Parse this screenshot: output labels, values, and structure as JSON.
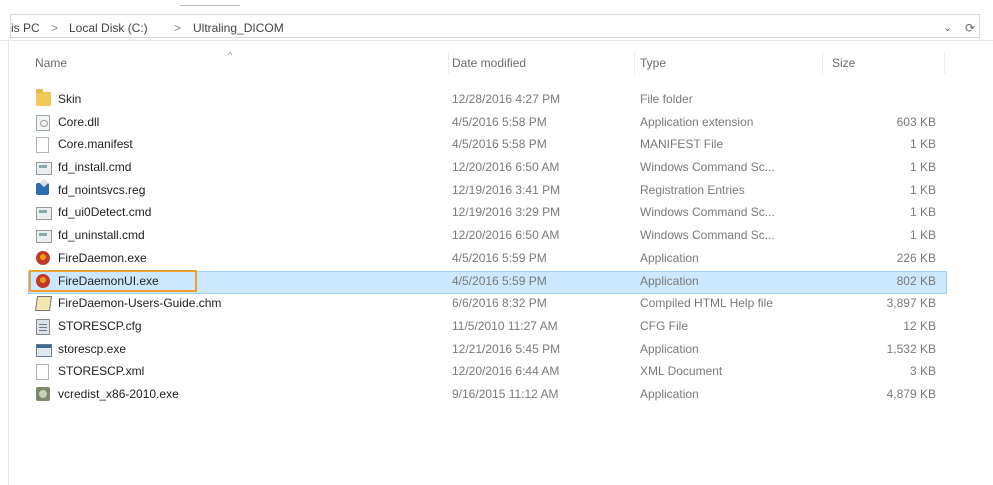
{
  "address": {
    "crumbs": [
      "is PC",
      "Local Disk (C:)",
      "Ultraling_DICOM"
    ],
    "separator": ">",
    "dropdown_glyph": "⌄",
    "refresh_glyph": "⟳"
  },
  "columns": {
    "name": "Name",
    "date": "Date modified",
    "type": "Type",
    "size": "Size",
    "sort_indicator": "^"
  },
  "files": [
    {
      "name": "Skin",
      "date": "12/28/2016 4:27 PM",
      "type": "File folder",
      "size": "",
      "icon": "folder-icon"
    },
    {
      "name": "Core.dll",
      "date": "4/5/2016 5:58 PM",
      "type": "Application extension",
      "size": "603 KB",
      "icon": "dll-file-icon"
    },
    {
      "name": "Core.manifest",
      "date": "4/5/2016 5:58 PM",
      "type": "MANIFEST File",
      "size": "1 KB",
      "icon": "blank-file-icon"
    },
    {
      "name": "fd_install.cmd",
      "date": "12/20/2016 6:50 AM",
      "type": "Windows Command Sc...",
      "size": "1 KB",
      "icon": "cmd-file-icon"
    },
    {
      "name": "fd_nointsvcs.reg",
      "date": "12/19/2016 3:41 PM",
      "type": "Registration Entries",
      "size": "1 KB",
      "icon": "registry-file-icon"
    },
    {
      "name": "fd_ui0Detect.cmd",
      "date": "12/19/2016 3:29 PM",
      "type": "Windows Command Sc...",
      "size": "1 KB",
      "icon": "cmd-file-icon"
    },
    {
      "name": "fd_uninstall.cmd",
      "date": "12/20/2016 6:50 AM",
      "type": "Windows Command Sc...",
      "size": "1 KB",
      "icon": "cmd-file-icon"
    },
    {
      "name": "FireDaemon.exe",
      "date": "4/5/2016 5:59 PM",
      "type": "Application",
      "size": "226 KB",
      "icon": "firedaemon-exe-icon"
    },
    {
      "name": "FireDaemonUI.exe",
      "date": "4/5/2016 5:59 PM",
      "type": "Application",
      "size": "802 KB",
      "icon": "firedaemon-exe-icon",
      "selected": true
    },
    {
      "name": "FireDaemon-Users-Guide.chm",
      "date": "6/6/2016 8:32 PM",
      "type": "Compiled HTML Help file",
      "size": "3,897 KB",
      "icon": "chm-file-icon"
    },
    {
      "name": "STORESCP.cfg",
      "date": "11/5/2010 11:27 AM",
      "type": "CFG File",
      "size": "12 KB",
      "icon": "cfg-file-icon"
    },
    {
      "name": "storescp.exe",
      "date": "12/21/2016 5:45 PM",
      "type": "Application",
      "size": "1,532 KB",
      "icon": "application-exe-icon"
    },
    {
      "name": "STORESCP.xml",
      "date": "12/20/2016 6:44 AM",
      "type": "XML Document",
      "size": "3 KB",
      "icon": "blank-file-icon"
    },
    {
      "name": "vcredist_x86-2010.exe",
      "date": "9/16/2015 11:12 AM",
      "type": "Application",
      "size": "4,879 KB",
      "icon": "installer-exe-icon"
    }
  ],
  "colors": {
    "selection_bg": "#cce8ff",
    "selection_border": "#99d1ff",
    "highlight_outline": "#f0a030"
  }
}
